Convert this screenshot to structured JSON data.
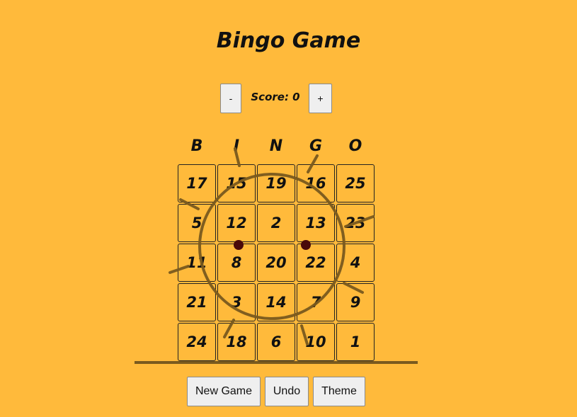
{
  "title": "Bingo Game",
  "score": {
    "decrement_label": "-",
    "increment_label": "+",
    "text": "Score: 0"
  },
  "board": {
    "headers": [
      "B",
      "I",
      "N",
      "G",
      "O"
    ],
    "rows": [
      [
        "17",
        "15",
        "19",
        "16",
        "25"
      ],
      [
        "5",
        "12",
        "2",
        "13",
        "23"
      ],
      [
        "11",
        "8",
        "20",
        "22",
        "4"
      ],
      [
        "21",
        "3",
        "14",
        "7",
        "9"
      ],
      [
        "24",
        "18",
        "6",
        "10",
        "1"
      ]
    ]
  },
  "buttons": {
    "new_game": "New Game",
    "undo": "Undo",
    "theme": "Theme"
  },
  "colors": {
    "background": "#FFBA3B",
    "sun_stroke": "#7a5a1e",
    "dot": "#4a0a0a"
  },
  "icons": [
    "sun-face-icon"
  ]
}
